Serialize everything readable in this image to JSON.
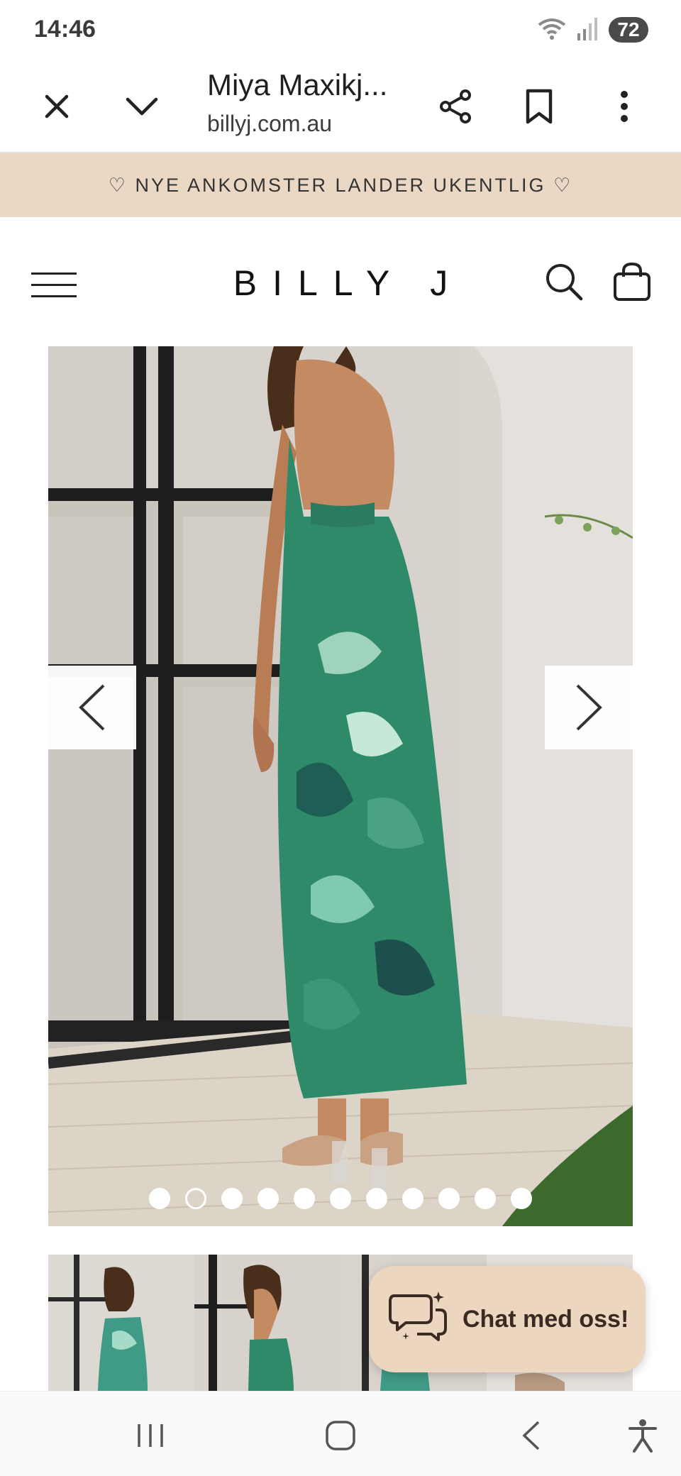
{
  "status_bar": {
    "time": "14:46",
    "battery": "72",
    "icons": [
      "wifi-icon",
      "signal-icon",
      "battery-icon"
    ]
  },
  "browser": {
    "page_title": "Miya Maxikj...",
    "url": "billyj.com.au",
    "icons": [
      "close-icon",
      "chevron-down-icon",
      "share-icon",
      "bookmark-icon",
      "more-icon"
    ]
  },
  "banner": {
    "text": "♡ NYE ANKOMSTER LANDER UKENTLIG ♡"
  },
  "site_header": {
    "logo": "BILLY J",
    "icons": [
      "menu-icon",
      "search-icon",
      "shopping-bag-icon"
    ]
  },
  "gallery": {
    "dot_count": 11,
    "active_index": 1,
    "icons": [
      "chevron-left-icon",
      "chevron-right-icon"
    ]
  },
  "thumbnails": {
    "count": 4
  },
  "chat": {
    "label": "Chat med oss!",
    "icon": "chat-bubble-icon"
  },
  "colors": {
    "banner_bg": "#ead8c4",
    "chat_bg": "#ecd6c0",
    "dress_green": "#2f8a6a"
  },
  "navbar": {
    "icons": [
      "recent-apps-icon",
      "home-icon",
      "back-icon",
      "accessibility-icon"
    ]
  }
}
